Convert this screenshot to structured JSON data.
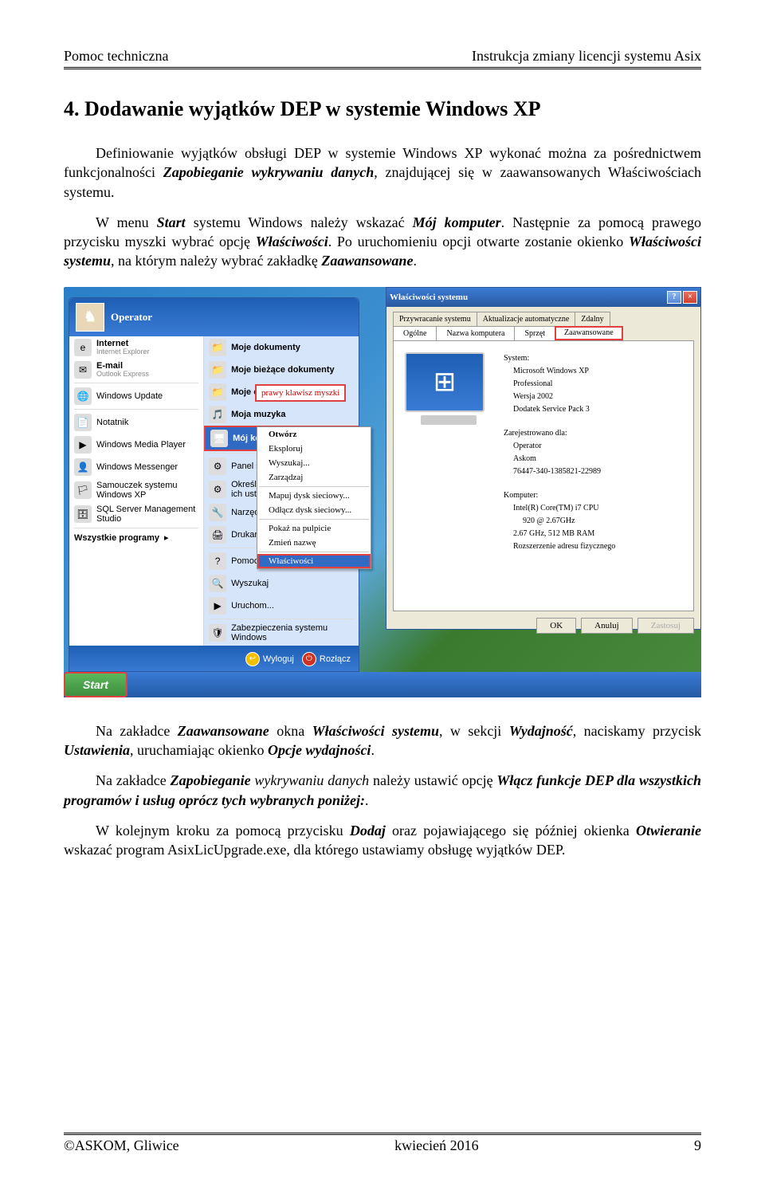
{
  "header": {
    "left": "Pomoc techniczna",
    "right": "Instrukcja zmiany licencji systemu Asix"
  },
  "title": "4. Dodawanie wyjątków DEP w systemie Windows XP",
  "p1_a": "Definiowanie wyjątków obsługi DEP w systemie Windows XP wykonać można za pośrednictwem funkcjonalności ",
  "p1_b": "Zapobieganie wykrywaniu danych",
  "p1_c": ", znajdującej się w zaawansowanych Właściwościach systemu.",
  "p2_a": "W menu ",
  "p2_b": "Start",
  "p2_c": " systemu Windows należy wskazać ",
  "p2_d": "Mój komputer",
  "p2_e": ". Następnie za pomocą prawego przycisku myszki wybrać opcję ",
  "p2_f": "Właściwości",
  "p2_g": ". Po uruchomieniu opcji otwarte zostanie okienko ",
  "p2_h": "Właściwości systemu",
  "p2_i": ", na którym należy wybrać zakładkę ",
  "p2_j": "Zaawansowane",
  "p2_k": ".",
  "sm": {
    "user": "Operator",
    "left": [
      {
        "t": "Internet",
        "s": "Internet Explorer"
      },
      {
        "t": "E-mail",
        "s": "Outlook Express"
      },
      {
        "t": "Windows Update",
        "s": ""
      },
      {
        "t": "Notatnik",
        "s": ""
      },
      {
        "t": "Windows Media Player",
        "s": ""
      },
      {
        "t": "Windows Messenger",
        "s": ""
      },
      {
        "t": "Samouczek systemu Windows XP",
        "s": ""
      },
      {
        "t": "SQL Server Management Studio",
        "s": ""
      }
    ],
    "allprog": "Wszystkie programy",
    "right": [
      "Moje dokumenty",
      "Moje bieżące dokumenty",
      "Moje obrazy",
      "Moja muzyka",
      "Mój komputer",
      "Panel sterowania",
      "Określ dostęp do programów i ich ustawienia domyślne",
      "Narzędzia administracyjne",
      "Drukarki i faksy",
      "Pomoc",
      "Wyszukaj",
      "Uruchom...",
      "Zabezpieczenia systemu Windows"
    ],
    "logout": "Wyloguj",
    "disconnect": "Rozłącz",
    "start": "Start"
  },
  "callout": "prawy klawisz myszki",
  "ctx": [
    "Otwórz",
    "Eksploruj",
    "Wyszukaj...",
    "Zarządzaj",
    "Mapuj dysk sieciowy...",
    "Odłącz dysk sieciowy...",
    "Pokaż na pulpicie",
    "Zmień nazwę",
    "Właściwości"
  ],
  "prop": {
    "title": "Właściwości systemu",
    "tabs1": [
      "Przywracanie systemu",
      "Aktualizacje automatyczne",
      "Zdalny"
    ],
    "tabs2": [
      "Ogólne",
      "Nazwa komputera",
      "Sprzęt",
      "Zaawansowane"
    ],
    "sys_label": "System:",
    "sys": [
      "Microsoft Windows XP",
      "Professional",
      "Wersja 2002",
      "Dodatek Service Pack 3"
    ],
    "reg_label": "Zarejestrowano dla:",
    "reg": [
      "Operator",
      "Askom",
      "76447-340-1385821-22989"
    ],
    "comp_label": "Komputer:",
    "comp": [
      "Intel(R) Core(TM) i7 CPU",
      "920 @ 2.67GHz",
      "2.67 GHz, 512 MB RAM",
      "Rozszerzenie adresu fizycznego"
    ],
    "ok": "OK",
    "cancel": "Anuluj",
    "apply": "Zastosuj"
  },
  "p3_a": "Na zakładce ",
  "p3_b": "Zaawansowane",
  "p3_c": " okna ",
  "p3_d": "Właściwości systemu",
  "p3_e": ", w sekcji ",
  "p3_f": "Wydajność",
  "p3_g": ", naciskamy przycisk ",
  "p3_h": "Ustawienia",
  "p3_i": ", uruchamiając okienko ",
  "p3_j": "Opcje wydajności",
  "p3_k": ".",
  "p4_a": "Na zakładce ",
  "p4_b": "Zapobieganie",
  "p4_c": " wykrywaniu danych",
  "p4_d": " należy ustawić opcję ",
  "p4_e": "Włącz funkcje DEP dla wszystkich programów i usług oprócz tych wybranych  poniżej:",
  "p4_f": ".",
  "p5_a": "W kolejnym kroku za pomocą przycisku ",
  "p5_b": "Dodaj",
  "p5_c": " oraz pojawiającego się później okienka ",
  "p5_d": "Otwieranie",
  "p5_e": " wskazać program AsixLicUpgrade.exe, dla którego ustawiamy obsługę wyjątków DEP.",
  "footer": {
    "left": "©ASKOM, Gliwice",
    "center": "kwiecień 2016",
    "right": "9"
  }
}
